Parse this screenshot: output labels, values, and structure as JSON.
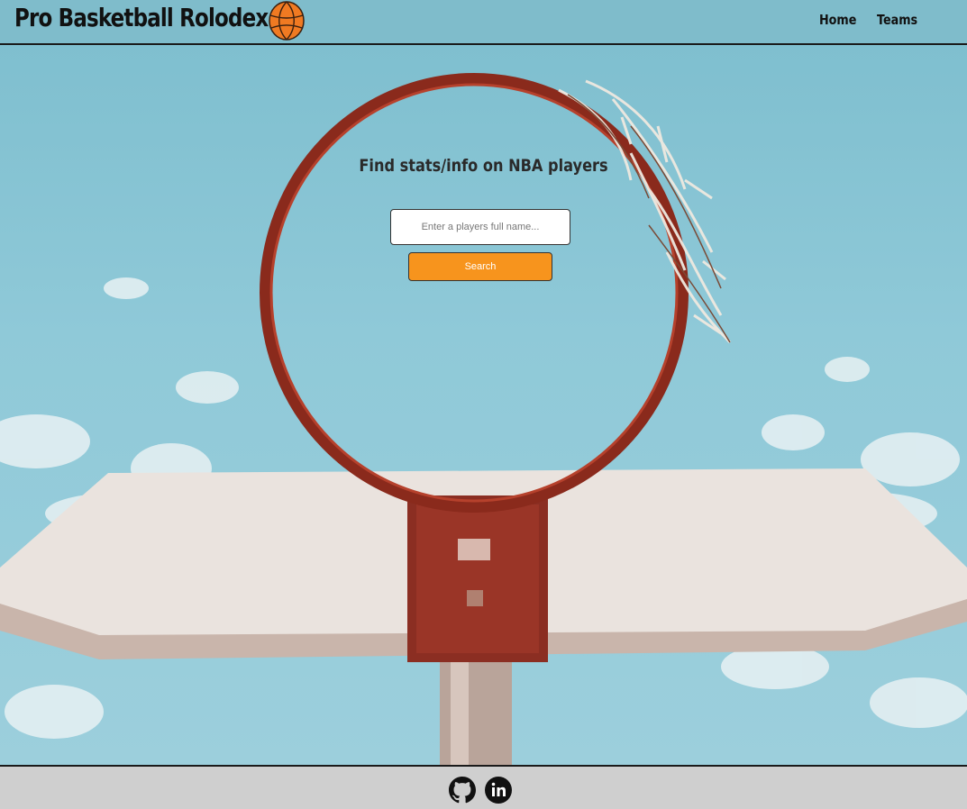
{
  "header": {
    "brand": "Pro Basketball Rolodex",
    "logo_icon": "basketball-icon",
    "nav": [
      {
        "label": "Home"
      },
      {
        "label": "Teams"
      }
    ]
  },
  "main": {
    "headline": "Find stats/info on NBA players",
    "search": {
      "placeholder": "Enter a players full name...",
      "value": "",
      "button_label": "Search"
    },
    "accent_color": "#f7941d"
  },
  "footer": {
    "icons": [
      "github-icon",
      "linkedin-icon"
    ]
  }
}
